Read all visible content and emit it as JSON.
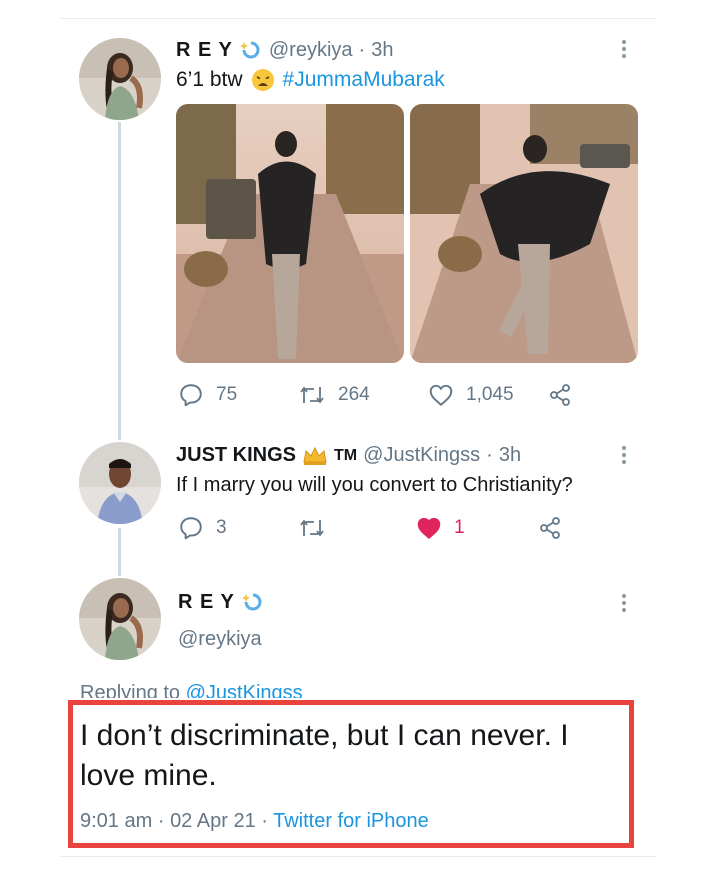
{
  "tweet1": {
    "display_name": "R E Y",
    "handle": "@reykiya",
    "separator": "·",
    "time": "3h",
    "text_main": "6’1 btw",
    "hashtag": "#JummaMubarak",
    "replies": "75",
    "retweets": "264",
    "likes": "1,045"
  },
  "tweet2": {
    "display_name": "JUST KINGS",
    "tm": "TM",
    "handle": "@JustKingss",
    "separator": "·",
    "time": "3h",
    "text": "If I marry you will you convert to Christianity?",
    "replies": "3",
    "likes": "1"
  },
  "main_tweet": {
    "display_name": "R E Y",
    "handle": "@reykiya",
    "replying_prefix": "Replying to",
    "replying_handle": "@JustKingss",
    "text": "I don’t discriminate, but I can never. I love mine.",
    "time": "9:01 am",
    "dot": "·",
    "date": "02 Apr 21",
    "source": "Twitter for iPhone"
  },
  "colors": {
    "accent": "#1b95e0",
    "like": "#e0245e",
    "highlight_border": "#e8433c",
    "muted": "#657786"
  },
  "icons": [
    "reply-icon",
    "retweet-icon",
    "heart-icon",
    "share-icon",
    "more-icon",
    "sparkle-emoji-icon",
    "crown-emoji-icon",
    "weary-face-emoji-icon"
  ]
}
